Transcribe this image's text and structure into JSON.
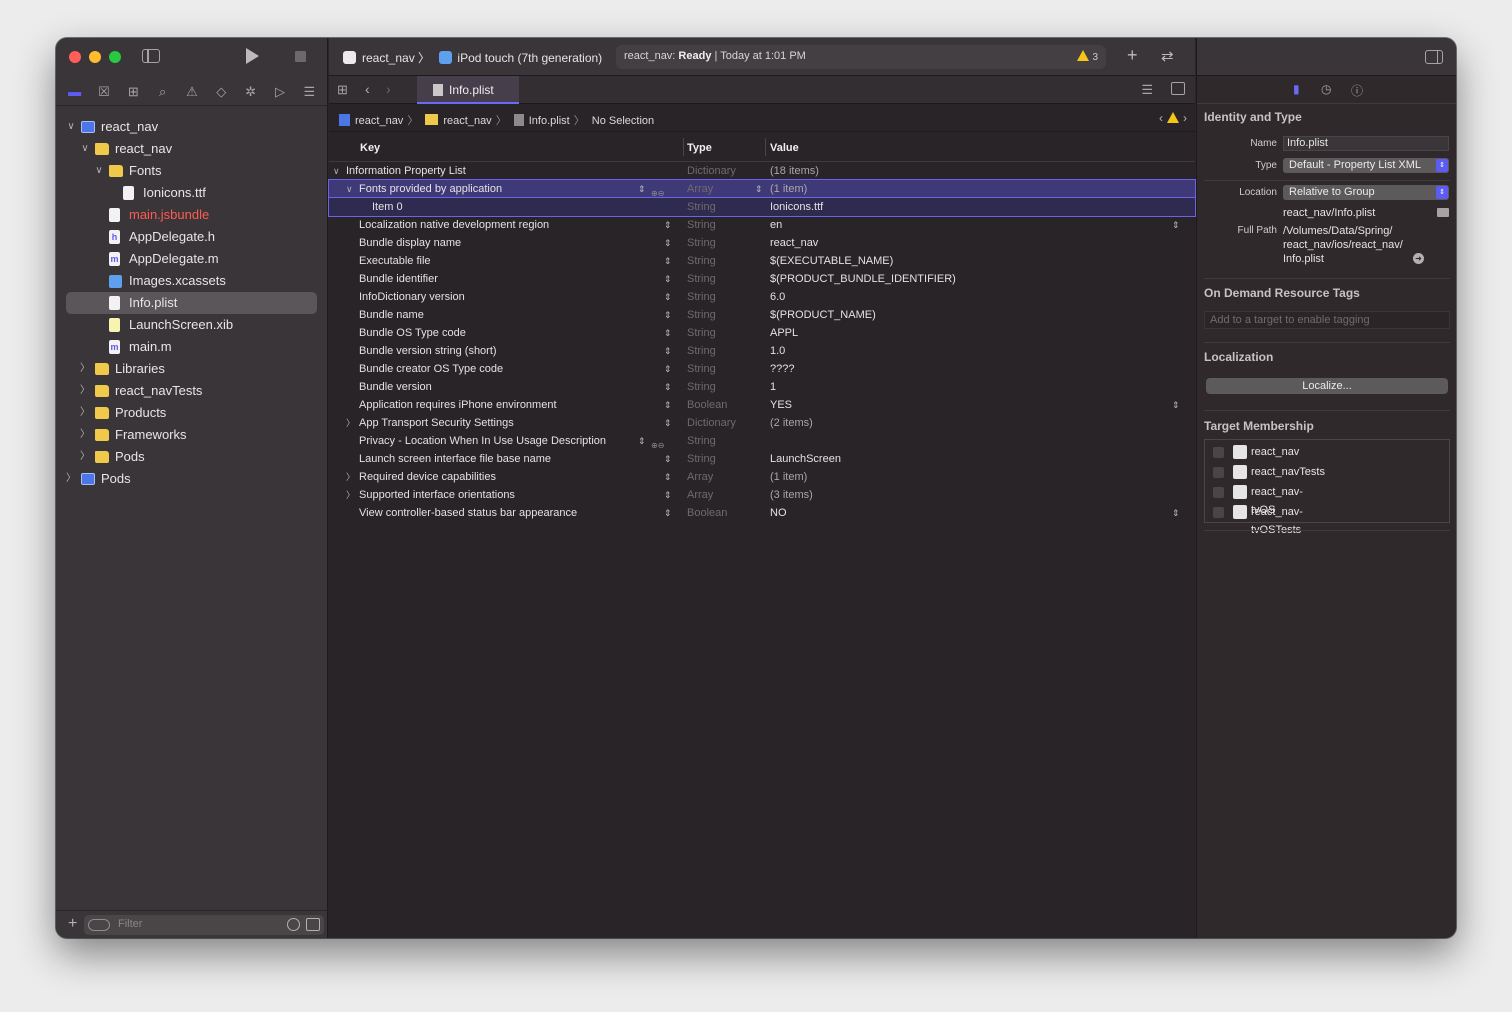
{
  "toolbar": {
    "scheme_name": "react_nav",
    "scheme_sep": "〉",
    "device_name": "iPod touch (7th generation)",
    "activity_prefix": "react_nav: ",
    "activity_status": "Ready",
    "activity_suffix": " | Today at 1:01 PM",
    "warning_count": "3"
  },
  "navigator": {
    "tree": [
      {
        "label": "react_nav",
        "icon": "project-icon",
        "depth": 0,
        "chevron": "∨"
      },
      {
        "label": "react_nav",
        "icon": "folder-icon",
        "depth": 1,
        "chevron": "∨"
      },
      {
        "label": "Fonts",
        "icon": "folder-icon",
        "depth": 2,
        "chevron": "∨"
      },
      {
        "label": "Ionicons.ttf",
        "icon": "file-icon",
        "depth": 3,
        "chevron": ""
      },
      {
        "label": "main.jsbundle",
        "icon": "file-icon",
        "depth": 2,
        "chevron": "",
        "missing": true
      },
      {
        "label": "AppDelegate.h",
        "icon": "header-file-icon",
        "depth": 2,
        "chevron": ""
      },
      {
        "label": "AppDelegate.m",
        "icon": "source-file-icon",
        "depth": 2,
        "chevron": ""
      },
      {
        "label": "Images.xcassets",
        "icon": "asset-catalog-icon",
        "depth": 2,
        "chevron": ""
      },
      {
        "label": "Info.plist",
        "icon": "plist-file-icon",
        "depth": 2,
        "chevron": "",
        "selected": true
      },
      {
        "label": "LaunchScreen.xib",
        "icon": "xib-file-icon",
        "depth": 2,
        "chevron": ""
      },
      {
        "label": "main.m",
        "icon": "source-file-icon",
        "depth": 2,
        "chevron": ""
      },
      {
        "label": "Libraries",
        "icon": "folder-icon",
        "depth": 1,
        "chevron": "〉"
      },
      {
        "label": "react_navTests",
        "icon": "folder-icon",
        "depth": 1,
        "chevron": "〉"
      },
      {
        "label": "Products",
        "icon": "folder-icon",
        "depth": 1,
        "chevron": "〉"
      },
      {
        "label": "Frameworks",
        "icon": "folder-icon",
        "depth": 1,
        "chevron": "〉"
      },
      {
        "label": "Pods",
        "icon": "folder-icon",
        "depth": 1,
        "chevron": "〉"
      },
      {
        "label": "Pods",
        "icon": "project-icon",
        "depth": 0,
        "chevron": "〉"
      }
    ],
    "filter_placeholder": "Filter"
  },
  "editor": {
    "tab_label": "Info.plist",
    "jump_bar": [
      "react_nav",
      "react_nav",
      "Info.plist",
      "No Selection"
    ],
    "columns": {
      "key": "Key",
      "type": "Type",
      "value": "Value"
    },
    "rows": [
      {
        "key": "Information Property List",
        "type": "Dictionary",
        "value": "(18 items)",
        "indent": 0,
        "chevron": "∨",
        "dim_value": true
      },
      {
        "key": "Fonts provided by application",
        "type": "Array",
        "value": "(1 item)",
        "indent": 1,
        "chevron": "∨",
        "selected": true,
        "dim_value": true
      },
      {
        "key": "Item 0",
        "type": "String",
        "value": "Ionicons.ttf",
        "indent": 2,
        "chevron": "",
        "child_selected": true
      },
      {
        "key": "Localization native development region",
        "type": "String",
        "value": "en",
        "indent": 1,
        "chevron": "",
        "value_popup": true
      },
      {
        "key": "Bundle display name",
        "type": "String",
        "value": "react_nav",
        "indent": 1,
        "chevron": ""
      },
      {
        "key": "Executable file",
        "type": "String",
        "value": "$(EXECUTABLE_NAME)",
        "indent": 1,
        "chevron": ""
      },
      {
        "key": "Bundle identifier",
        "type": "String",
        "value": "$(PRODUCT_BUNDLE_IDENTIFIER)",
        "indent": 1,
        "chevron": ""
      },
      {
        "key": "InfoDictionary version",
        "type": "String",
        "value": "6.0",
        "indent": 1,
        "chevron": ""
      },
      {
        "key": "Bundle name",
        "type": "String",
        "value": "$(PRODUCT_NAME)",
        "indent": 1,
        "chevron": ""
      },
      {
        "key": "Bundle OS Type code",
        "type": "String",
        "value": "APPL",
        "indent": 1,
        "chevron": ""
      },
      {
        "key": "Bundle version string (short)",
        "type": "String",
        "value": "1.0",
        "indent": 1,
        "chevron": ""
      },
      {
        "key": "Bundle creator OS Type code",
        "type": "String",
        "value": "????",
        "indent": 1,
        "chevron": ""
      },
      {
        "key": "Bundle version",
        "type": "String",
        "value": "1",
        "indent": 1,
        "chevron": ""
      },
      {
        "key": "Application requires iPhone environment",
        "type": "Boolean",
        "value": "YES",
        "indent": 1,
        "chevron": "",
        "value_popup": true
      },
      {
        "key": "App Transport Security Settings",
        "type": "Dictionary",
        "value": "(2 items)",
        "indent": 1,
        "chevron": "〉",
        "dim_value": true
      },
      {
        "key": "Privacy - Location When In Use Usage Description",
        "type": "String",
        "value": "",
        "indent": 1,
        "chevron": "",
        "show_plus_minus": true
      },
      {
        "key": "Launch screen interface file base name",
        "type": "String",
        "value": "LaunchScreen",
        "indent": 1,
        "chevron": ""
      },
      {
        "key": "Required device capabilities",
        "type": "Array",
        "value": "(1 item)",
        "indent": 1,
        "chevron": "〉",
        "dim_value": true
      },
      {
        "key": "Supported interface orientations",
        "type": "Array",
        "value": "(3 items)",
        "indent": 1,
        "chevron": "〉",
        "dim_value": true
      },
      {
        "key": "View controller-based status bar appearance",
        "type": "Boolean",
        "value": "NO",
        "indent": 1,
        "chevron": "",
        "value_popup": true
      }
    ]
  },
  "inspector": {
    "identity_title": "Identity and Type",
    "name_label": "Name",
    "name_value": "Info.plist",
    "type_label": "Type",
    "type_value": "Default - Property List XML",
    "location_label": "Location",
    "location_value": "Relative to Group",
    "relative_path": "react_nav/Info.plist",
    "full_path_label": "Full Path",
    "full_path_lines": [
      "/Volumes/Data/Spring/",
      "react_nav/ios/react_nav/",
      "Info.plist"
    ],
    "odr_title": "On Demand Resource Tags",
    "odr_placeholder": "Add to a target to enable tagging",
    "localization_title": "Localization",
    "localize_button": "Localize...",
    "membership_title": "Target Membership",
    "targets": [
      "react_nav",
      "react_navTests",
      "react_nav-tvOS",
      "react_nav-tvOSTests"
    ]
  },
  "colors": {
    "accent": "#6b6af4",
    "selection": "#3f3a77",
    "folder": "#f1c94a",
    "missing_file": "#ff5b55"
  }
}
